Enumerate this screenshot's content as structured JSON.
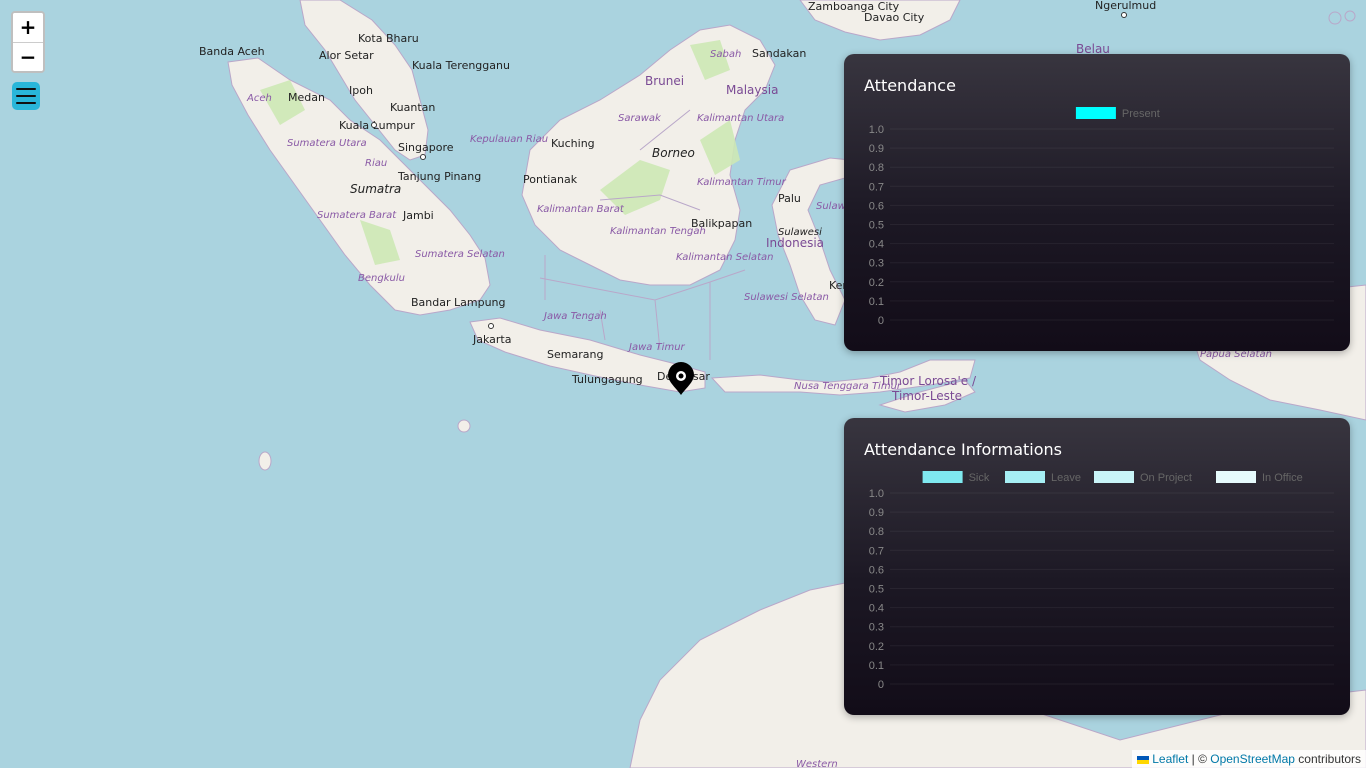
{
  "map": {
    "countries": [
      "Malaysia",
      "Brunei",
      "Indonesia",
      "Belau",
      "Timor Lorosa'e /",
      "Timor-Leste"
    ],
    "cities": [
      "Banda Aceh",
      "Kota Bharu",
      "Alor Setar",
      "Kuala Terengganu",
      "Ipoh",
      "Medan",
      "Kuantan",
      "Kuala Lumpur",
      "Singapore",
      "Tanjung Pinang",
      "Pontianak",
      "Kuching",
      "Jambi",
      "Bandar Lampung",
      "Jakarta",
      "Semarang",
      "Tulungagung",
      "Denpasar",
      "Balikpapan",
      "Palu",
      "Sandakan",
      "Zamboanga City",
      "Davao City",
      "Ngerulmud",
      "Ker"
    ],
    "regions": [
      "Aceh",
      "Sumatera Utara",
      "Riau",
      "Sumatera Barat",
      "Sumatera Selatan",
      "Bengkulu",
      "Kepulauan Riau",
      "Sarawak",
      "Sabah",
      "Kalimantan Utara",
      "Kalimantan Barat",
      "Kalimantan Tengah",
      "Kalimantan Timur",
      "Kalimantan Selatan",
      "Jawa Tengah",
      "Jawa Timur",
      "Sulawesi Selatan",
      "Nusa Tenggara Timur",
      "Papua Selatan",
      "Western",
      "Sulaw"
    ],
    "islands": [
      "Sumatra",
      "Borneo",
      "Sulawesi"
    ]
  },
  "zoom": {
    "in_label": "+",
    "out_label": "−"
  },
  "menu": {
    "icon": "hamburger-icon"
  },
  "marker": {
    "icon": "map-marker-icon"
  },
  "attendance_panel": {
    "title": "Attendance",
    "chart_data": {
      "type": "bar",
      "categories": [],
      "series": [
        {
          "name": "Present",
          "values": [],
          "color": "#00ffff"
        }
      ],
      "ylim": [
        0,
        1.0
      ],
      "yticks": [
        "1.0",
        "0.9",
        "0.8",
        "0.7",
        "0.6",
        "0.5",
        "0.4",
        "0.3",
        "0.2",
        "0.1",
        "0"
      ],
      "legend": "top"
    }
  },
  "info_panel": {
    "title": "Attendance Informations",
    "chart_data": {
      "type": "bar",
      "categories": [],
      "series": [
        {
          "name": "Sick",
          "values": [],
          "color": "#7fe9f0"
        },
        {
          "name": "Leave",
          "values": [],
          "color": "#a6eff4"
        },
        {
          "name": "On Project",
          "values": [],
          "color": "#c9f5f8"
        },
        {
          "name": "In Office",
          "values": [],
          "color": "#e6fbfc"
        }
      ],
      "ylim": [
        0,
        1.0
      ],
      "yticks": [
        "1.0",
        "0.9",
        "0.8",
        "0.7",
        "0.6",
        "0.5",
        "0.4",
        "0.3",
        "0.2",
        "0.1",
        "0"
      ],
      "legend": "top"
    }
  },
  "attribution": {
    "leaflet": "Leaflet",
    "separator": " | © ",
    "osm": "OpenStreetMap",
    "contributors": " contributors",
    "flag_colors": [
      "#0057b7",
      "#ffd700"
    ]
  }
}
